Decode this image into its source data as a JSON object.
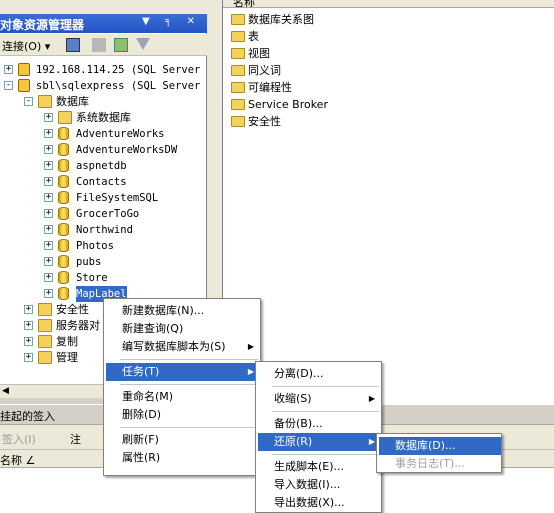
{
  "object_explorer": {
    "title": "对象资源管理器",
    "title_buttons": "▼ ╕ ✕",
    "connect_label": "连接(O) ▾",
    "tree": [
      {
        "id": "server1",
        "label": "192.168.114.25 (SQL Server",
        "level": 0,
        "icon": "server-icon",
        "expander": "+"
      },
      {
        "id": "server2",
        "label": "sbl\\sqlexpress (SQL Server",
        "level": 0,
        "icon": "server-icon",
        "expander": "-"
      },
      {
        "id": "databases",
        "label": "数据库",
        "level": 1,
        "icon": "folder-icon",
        "expander": "-",
        "cn": true
      },
      {
        "id": "sysdb",
        "label": "系统数据库",
        "level": 2,
        "icon": "folder-icon",
        "expander": "+",
        "cn": true
      },
      {
        "id": "aw",
        "label": "AdventureWorks",
        "level": 2,
        "icon": "database-icon",
        "expander": "+"
      },
      {
        "id": "awdw",
        "label": "AdventureWorksDW",
        "level": 2,
        "icon": "database-icon",
        "expander": "+"
      },
      {
        "id": "aspnetdb",
        "label": "aspnetdb",
        "level": 2,
        "icon": "database-icon",
        "expander": "+"
      },
      {
        "id": "contacts",
        "label": "Contacts",
        "level": 2,
        "icon": "database-icon",
        "expander": "+"
      },
      {
        "id": "fssql",
        "label": "FileSystemSQL",
        "level": 2,
        "icon": "database-icon",
        "expander": "+"
      },
      {
        "id": "grocer",
        "label": "GrocerToGo",
        "level": 2,
        "icon": "database-icon",
        "expander": "+"
      },
      {
        "id": "northwind",
        "label": "Northwind",
        "level": 2,
        "icon": "database-icon",
        "expander": "+"
      },
      {
        "id": "photos",
        "label": "Photos",
        "level": 2,
        "icon": "database-icon",
        "expander": "+"
      },
      {
        "id": "pubs",
        "label": "pubs",
        "level": 2,
        "icon": "database-icon",
        "expander": "+"
      },
      {
        "id": "store",
        "label": "Store",
        "level": 2,
        "icon": "database-icon",
        "expander": "+"
      },
      {
        "id": "maplabel",
        "label": "MapLabel",
        "level": 2,
        "icon": "database-icon",
        "expander": "+",
        "selected": true
      },
      {
        "id": "security",
        "label": "安全性",
        "level": 1,
        "icon": "folder-icon",
        "expander": "+",
        "cn": true
      },
      {
        "id": "serverobj",
        "label": "服务器对",
        "level": 1,
        "icon": "folder-icon",
        "expander": "+",
        "cn": true
      },
      {
        "id": "replication",
        "label": "复制",
        "level": 1,
        "icon": "folder-icon",
        "expander": "+",
        "cn": true
      },
      {
        "id": "management",
        "label": "管理",
        "level": 1,
        "icon": "folder-icon",
        "expander": "+",
        "cn": true
      }
    ]
  },
  "details": {
    "column_header": "名称",
    "items": [
      "数据库关系图",
      "表",
      "视图",
      "同义词",
      "可编程性",
      "Service Broker",
      "安全性"
    ]
  },
  "pending": {
    "title": "挂起的签入",
    "checkin_label": "签入(I)",
    "comment_label": "注",
    "column_name": "名称 ∠"
  },
  "menu1": {
    "items": [
      {
        "label": "新建数据库(N)...",
        "type": "item"
      },
      {
        "label": "新建查询(Q)",
        "type": "item"
      },
      {
        "label": "编写数据库脚本为(S)",
        "type": "item",
        "submenu": true
      },
      {
        "type": "sep"
      },
      {
        "label": "任务(T)",
        "type": "item",
        "submenu": true,
        "highlight": true
      },
      {
        "type": "sep"
      },
      {
        "label": "重命名(M)",
        "type": "item"
      },
      {
        "label": "删除(D)",
        "type": "item"
      },
      {
        "type": "sep"
      },
      {
        "label": "刷新(F)",
        "type": "item"
      },
      {
        "label": "属性(R)",
        "type": "item"
      }
    ]
  },
  "menu2": {
    "items": [
      {
        "label": "分离(D)...",
        "type": "item"
      },
      {
        "type": "sep"
      },
      {
        "label": "收缩(S)",
        "type": "item",
        "submenu": true
      },
      {
        "type": "sep"
      },
      {
        "label": "备份(B)...",
        "type": "item"
      },
      {
        "label": "还原(R)",
        "type": "item",
        "submenu": true,
        "highlight": true
      },
      {
        "type": "sep"
      },
      {
        "label": "生成脚本(E)...",
        "type": "item"
      },
      {
        "label": "导入数据(I)...",
        "type": "item"
      },
      {
        "label": "导出数据(X)...",
        "type": "item"
      }
    ]
  },
  "menu3": {
    "items": [
      {
        "label": "数据库(D)...",
        "type": "item",
        "highlight": true
      },
      {
        "label": "事务日志(T)...",
        "type": "item",
        "disabled": true
      }
    ]
  }
}
